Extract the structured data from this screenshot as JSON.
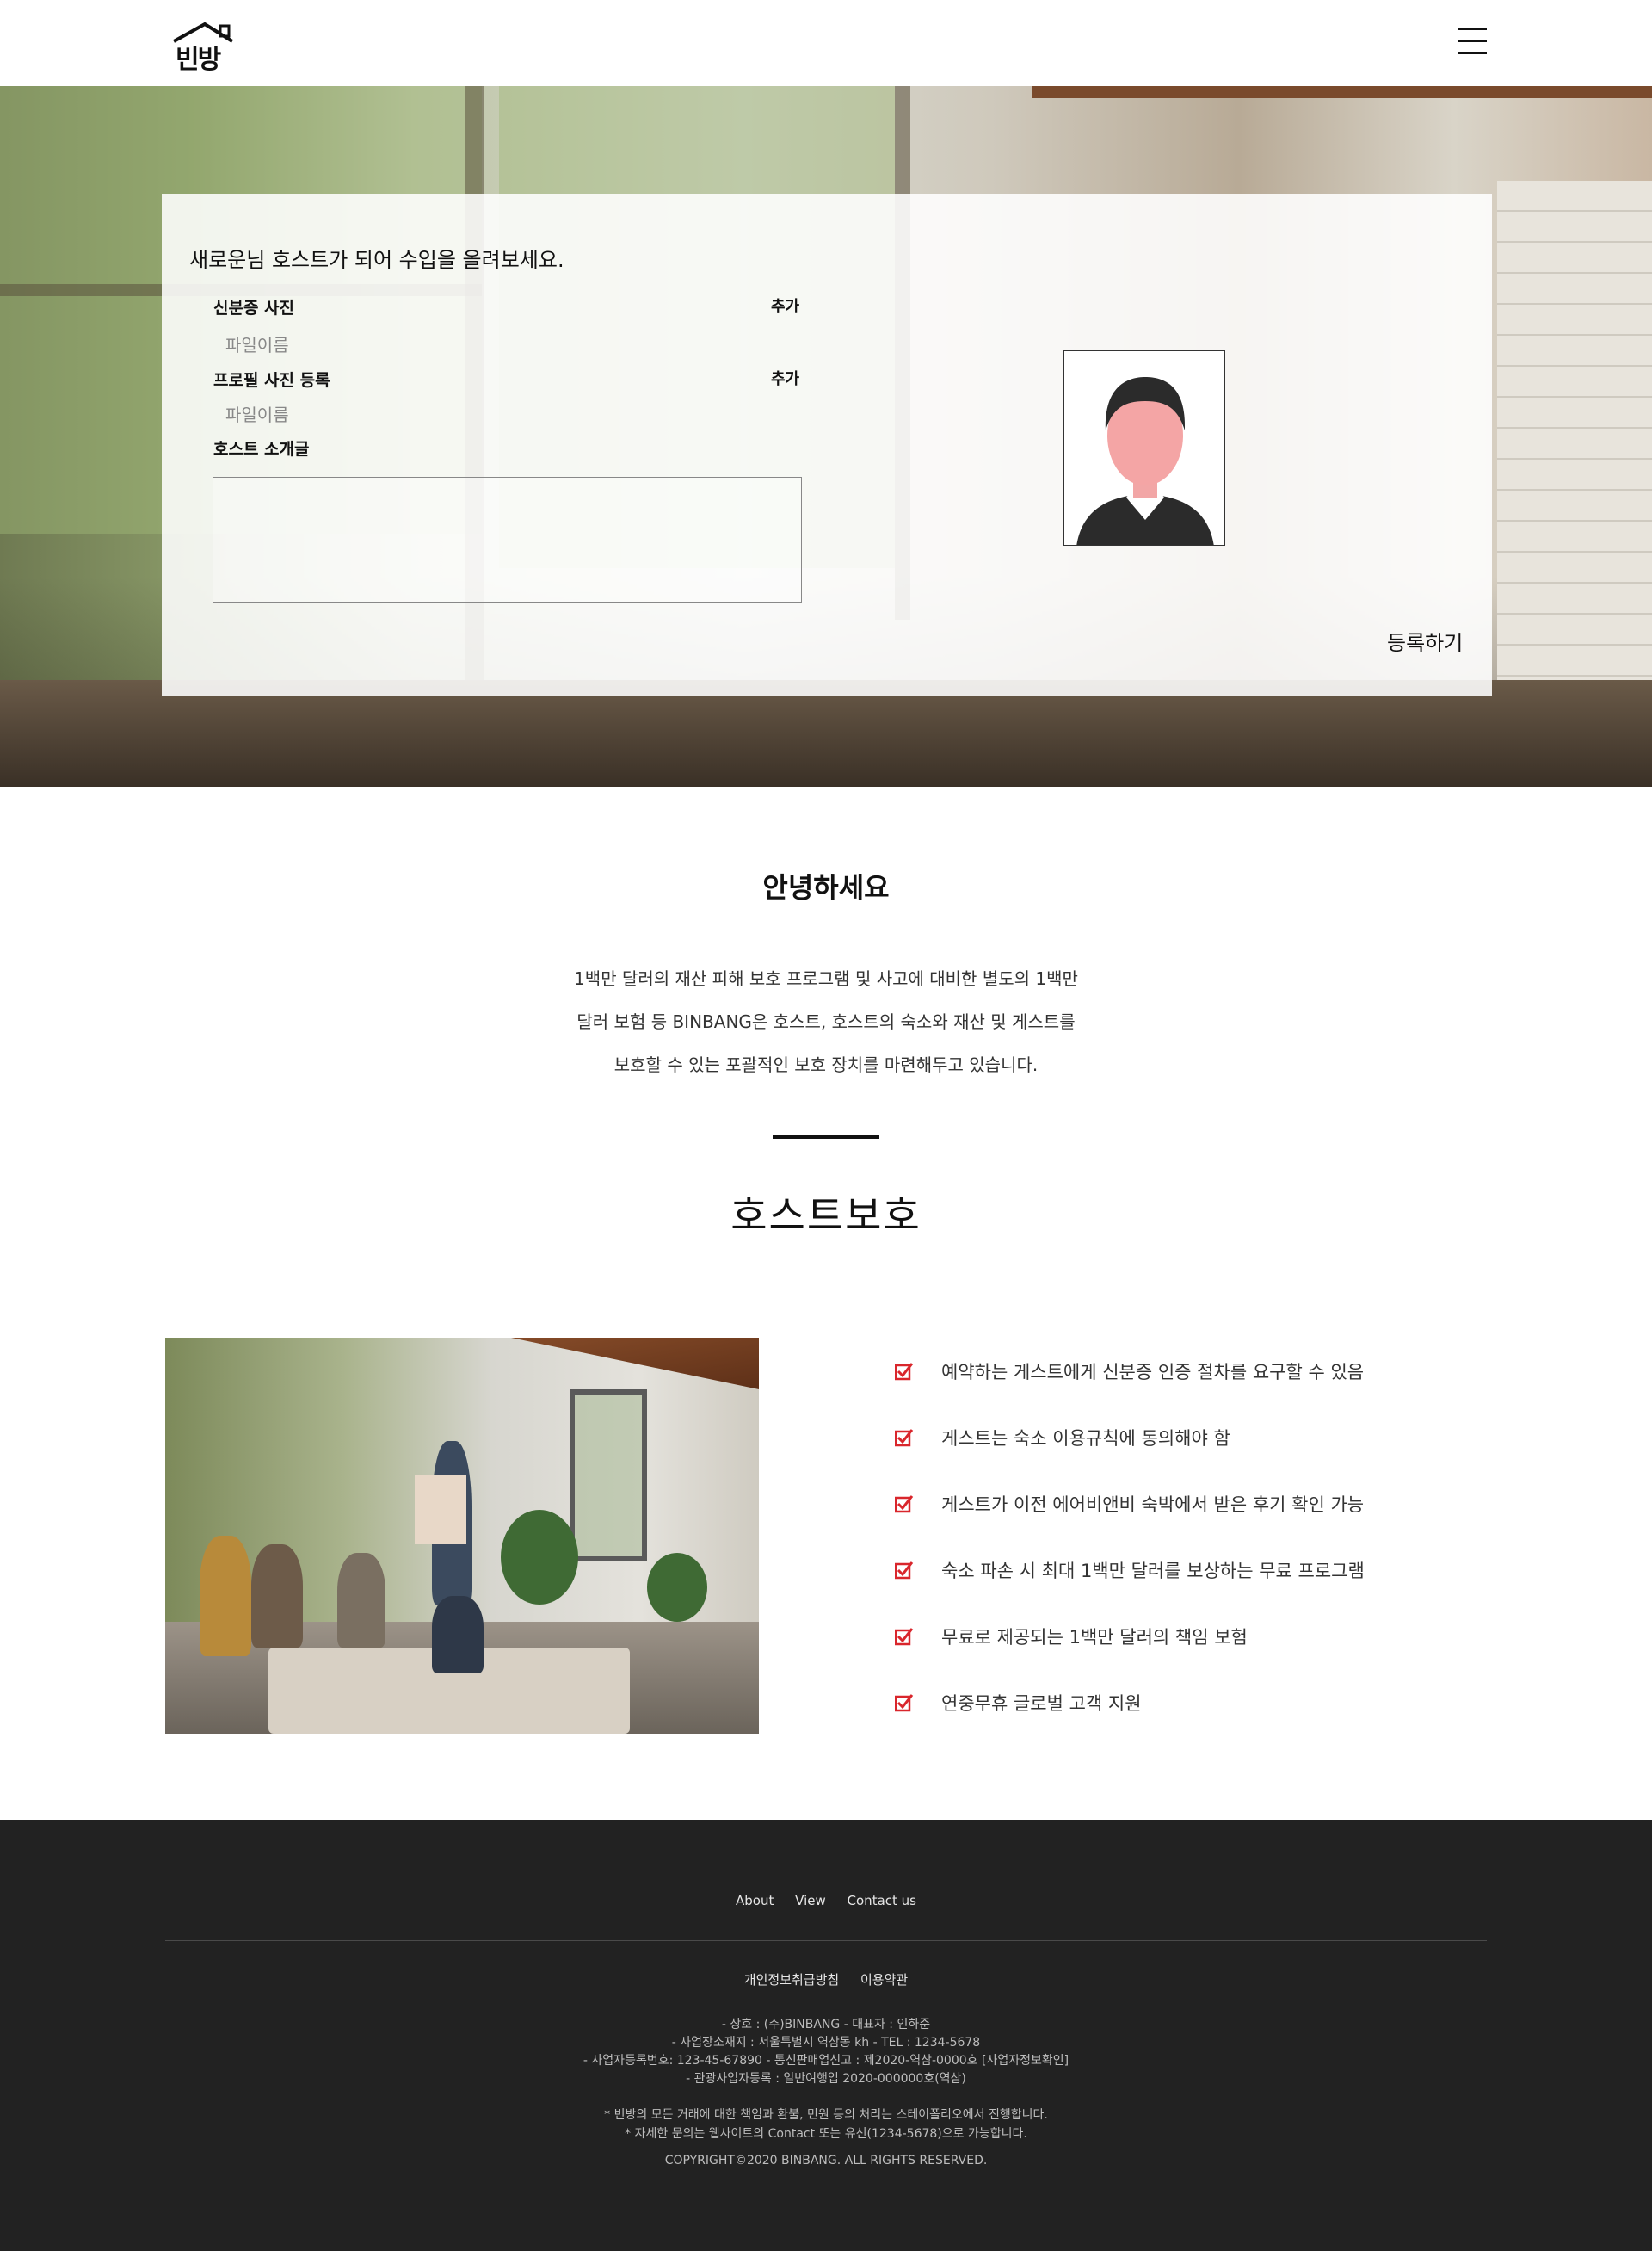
{
  "header": {
    "logo_text": "빈방"
  },
  "form": {
    "title": "새로운님 호스트가 되어 수입을 올려보세요.",
    "id_photo_label": "신분증 사진",
    "id_photo_add": "추가",
    "id_photo_file": "파일이름",
    "profile_photo_label": "프로필 사진 등록",
    "profile_photo_add": "추가",
    "profile_photo_file": "파일이름",
    "intro_label": "호스트 소개글",
    "intro_value": "",
    "submit_label": "등록하기"
  },
  "info": {
    "greeting": "안녕하세요",
    "description_lines": [
      "1백만 달러의 재산 피해 보호 프로그램 및 사고에 대비한 별도의 1백만",
      "달러 보험 등 BINBANG은 호스트, 호스트의 숙소와 재산 및 게스트를",
      "보호할 수 있는 포괄적인 보호 장치를 마련해두고 있습니다."
    ],
    "section_title": "호스트보호"
  },
  "features": [
    "예약하는 게스트에게 신분증 인증 절차를 요구할 수 있음",
    "게스트는 숙소 이용규칙에 동의해야 함",
    "게스트가 이전 에어비앤비 숙박에서 받은 후기 확인 가능",
    "숙소 파손 시 최대 1백만 달러를 보상하는 무료 프로그램",
    "무료로 제공되는 1백만 달러의 책임 보험",
    "연중무휴 글로벌 고객 지원"
  ],
  "footer": {
    "nav": [
      "About",
      "View",
      "Contact us"
    ],
    "policy": [
      "개인정보취급방침",
      "이용약관"
    ],
    "company_lines": [
      "- 상호 : (주)BINBANG - 대표자 : 인하준",
      "- 사업장소재지 : 서울특별시 역삼동 kh - TEL : 1234-5678",
      "- 사업자등록번호: 123-45-67890 - 통신판매업신고 : 제2020-역삼-0000호 [사업자정보확인]",
      "- 관광사업자등록 : 일반여행업 2020-000000호(역삼)"
    ],
    "notice_lines": [
      "* 빈방의 모든 거래에 대한 책임과 환불, 민원 등의 처리는 스테이폴리오에서 진행합니다.",
      "* 자세한 문의는 웹사이트의 Contact 또는 유선(1234-5678)으로 가능합니다."
    ],
    "copyright": "COPYRIGHT©2020 BINBANG. ALL RIGHTS RESERVED."
  },
  "colors": {
    "check_red": "#d9262c",
    "footer_bg": "#222222"
  },
  "icons": {
    "menu": "hamburger-menu-icon",
    "check": "checkbox-checked-icon",
    "avatar": "person-silhouette-icon"
  }
}
